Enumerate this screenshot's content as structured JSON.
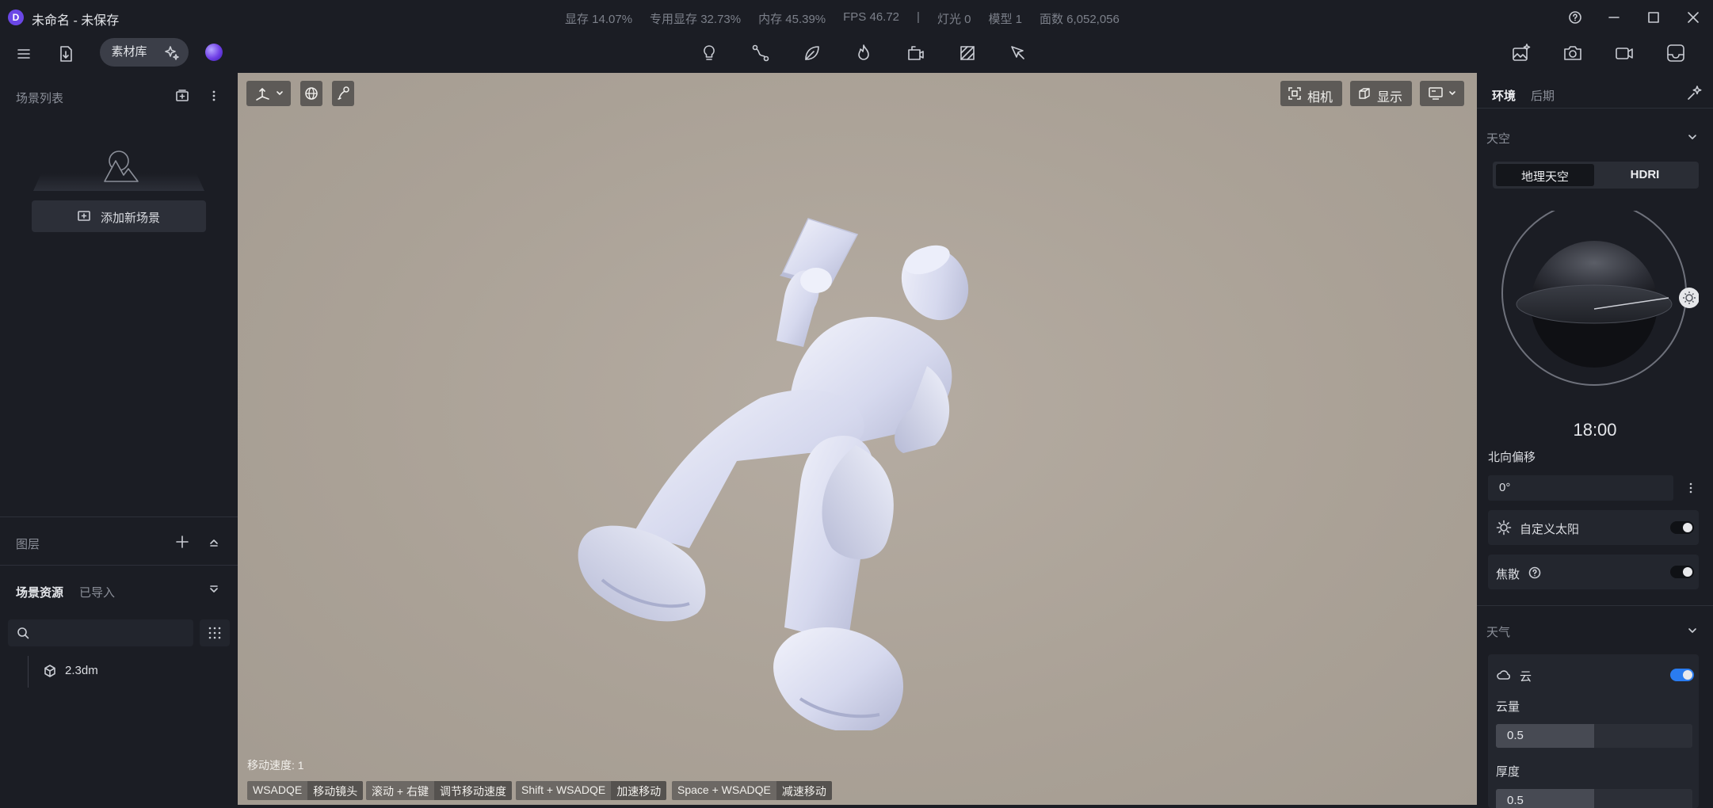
{
  "window": {
    "logo": "D",
    "title": "未命名 - 未保存",
    "stats": [
      "显存 14.07%",
      "专用显存 32.73%",
      "内存 45.39%",
      "FPS 46.72",
      "|",
      "灯光 0",
      "模型 1",
      "面数 6,052,056"
    ]
  },
  "toolbar": {
    "library_label": "素材库",
    "center_tools": [
      "bulb-icon",
      "path-icon",
      "leaf-icon",
      "fire-icon",
      "camera-mount-icon",
      "hatch-icon",
      "cursor-pen-icon"
    ],
    "right_tools": [
      "image-magic-icon",
      "camera-icon",
      "video-icon",
      "render-icon"
    ]
  },
  "left_panel": {
    "scene_list_title": "场景列表",
    "add_scene_label": "添加新场景",
    "layers_title": "图层",
    "assets_tab": "场景资源",
    "imported_tab": "已导入",
    "search_placeholder": "",
    "assets": [
      {
        "name": "2.3dm",
        "icon": "cube-icon"
      }
    ]
  },
  "viewport": {
    "camera_label": "相机",
    "display_label": "显示",
    "move_speed": "移动速度: 1",
    "hints": [
      {
        "key": "WSADQE",
        "desc": "移动镜头"
      },
      {
        "key": "滚动 + 右键",
        "desc": "调节移动速度"
      },
      {
        "key": "Shift + WSADQE",
        "desc": "加速移动"
      },
      {
        "key": "Space + WSADQE",
        "desc": "减速移动"
      }
    ],
    "background_color": "#aaa196"
  },
  "right_panel": {
    "tabs": [
      "环境",
      "后期"
    ],
    "sky": {
      "title": "天空",
      "options": [
        "地理天空",
        "HDRI"
      ],
      "selected": "地理天空",
      "time": "18:00",
      "north_offset_label": "北向偏移",
      "north_offset_value": "0°",
      "custom_sun_label": "自定义太阳",
      "custom_sun_enabled": false,
      "dof_label": "焦散",
      "dof_enabled": false
    },
    "weather": {
      "title": "天气",
      "cloud_label": "云",
      "cloud_enabled": true,
      "cloud_amount_label": "云量",
      "cloud_amount": "0.5",
      "thickness_label": "厚度",
      "thickness": "0.5"
    },
    "accent_color": "#2a7cf0"
  }
}
